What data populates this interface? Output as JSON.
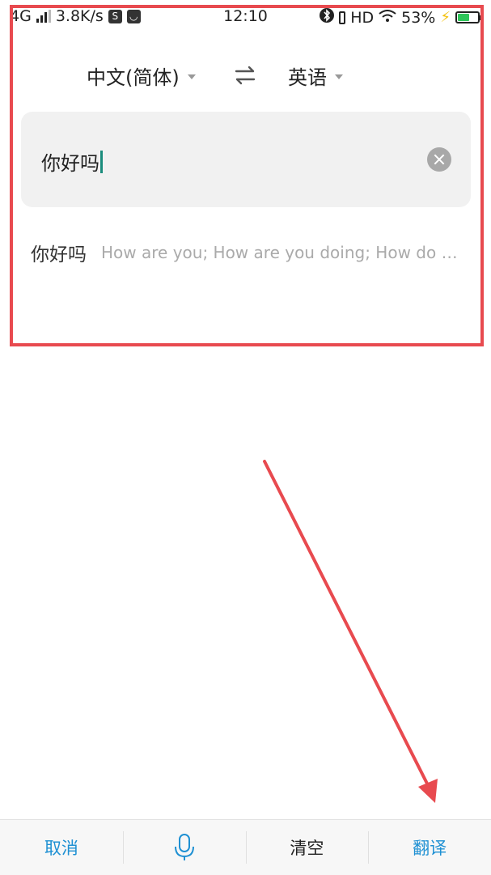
{
  "status_bar": {
    "network": "4G",
    "speed": "3.8K/s",
    "time": "12:10",
    "hd": "HD",
    "battery": "53%",
    "battery_level": 0.53
  },
  "lang_bar": {
    "source_lang": "中文(简体)",
    "target_lang": "英语",
    "swap_icon": "swap-arrows-icon"
  },
  "input": {
    "value": "你好吗",
    "clear_icon": "clear-circle-icon"
  },
  "suggestion": {
    "word": "你好吗",
    "translation": "How are you; How are you doing; How do you do"
  },
  "bottom_bar": {
    "cancel": "取消",
    "mic_icon": "microphone-icon",
    "clear": "清空",
    "translate": "翻译"
  },
  "colors": {
    "accent": "#1e90d3",
    "annotation": "#e84a4f",
    "cursor": "#1a8c7c"
  }
}
